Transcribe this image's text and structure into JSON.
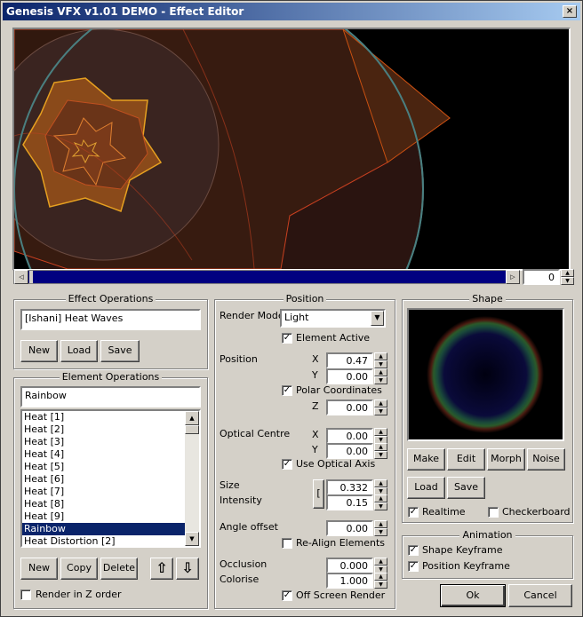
{
  "window": {
    "title": "Genesis VFX v1.01 DEMO  - Effect Editor",
    "close_glyph": "×"
  },
  "timeline": {
    "frame_value": "0",
    "left_arrow": "◁",
    "right_arrow": "▷"
  },
  "effect_ops": {
    "title": "Effect Operations",
    "name_value": "[Ishani] Heat Waves",
    "new_label": "New",
    "load_label": "Load",
    "save_label": "Save"
  },
  "element_ops": {
    "title": "Element Operations",
    "name_value": "Rainbow",
    "items": [
      "Heat [1]",
      "Heat [2]",
      "Heat [3]",
      "Heat [4]",
      "Heat [5]",
      "Heat [6]",
      "Heat [7]",
      "Heat [8]",
      "Heat [9]",
      "Rainbow",
      "Heat Distortion [2]"
    ],
    "selected_index": 9,
    "new_label": "New",
    "copy_label": "Copy",
    "delete_label": "Delete",
    "up_glyph": "⇧",
    "down_glyph": "⇩",
    "render_z_label": "Render in Z order",
    "render_z_checked": false
  },
  "position": {
    "title": "Position",
    "render_mode_label": "Render Mode",
    "render_mode_value": "Light",
    "element_active_label": "Element Active",
    "position_label": "Position",
    "x_label": "X",
    "y_label": "Y",
    "z_label": "Z",
    "pos_x": "0.47",
    "pos_y": "0.00",
    "polar_label": "Polar Coordinates",
    "pos_z": "0.00",
    "optical_label": "Optical Centre",
    "opt_x": "0.00",
    "opt_y": "0.00",
    "use_optical_label": "Use Optical Axis",
    "size_label": "Size",
    "intensity_label": "Intensity",
    "size_value": "0.332",
    "intensity_value": "0.15",
    "link_glyph": "[",
    "angle_label": "Angle offset",
    "angle_value": "0.00",
    "realign_label": "Re-Align Elements",
    "occlusion_label": "Occlusion",
    "occlusion_value": "0.000",
    "colorise_label": "Colorise",
    "colorise_value": "1.000",
    "offscreen_label": "Off Screen Render"
  },
  "shape": {
    "title": "Shape",
    "make_label": "Make",
    "edit_label": "Edit",
    "morph_label": "Morph",
    "noise_label": "Noise",
    "load_label": "Load",
    "save_label": "Save",
    "realtime_label": "Realtime",
    "checkerboard_label": "Checkerboard"
  },
  "animation": {
    "title": "Animation",
    "shape_kf_label": "Shape Keyframe",
    "position_kf_label": "Position Keyframe"
  },
  "dialog": {
    "ok_label": "Ok",
    "cancel_label": "Cancel"
  },
  "check_glyph": "✓",
  "colors": {
    "titlebar": "#0a246a",
    "selection": "#0a246a",
    "timeline_bar": "#000080",
    "face": "#d4d0c8"
  }
}
